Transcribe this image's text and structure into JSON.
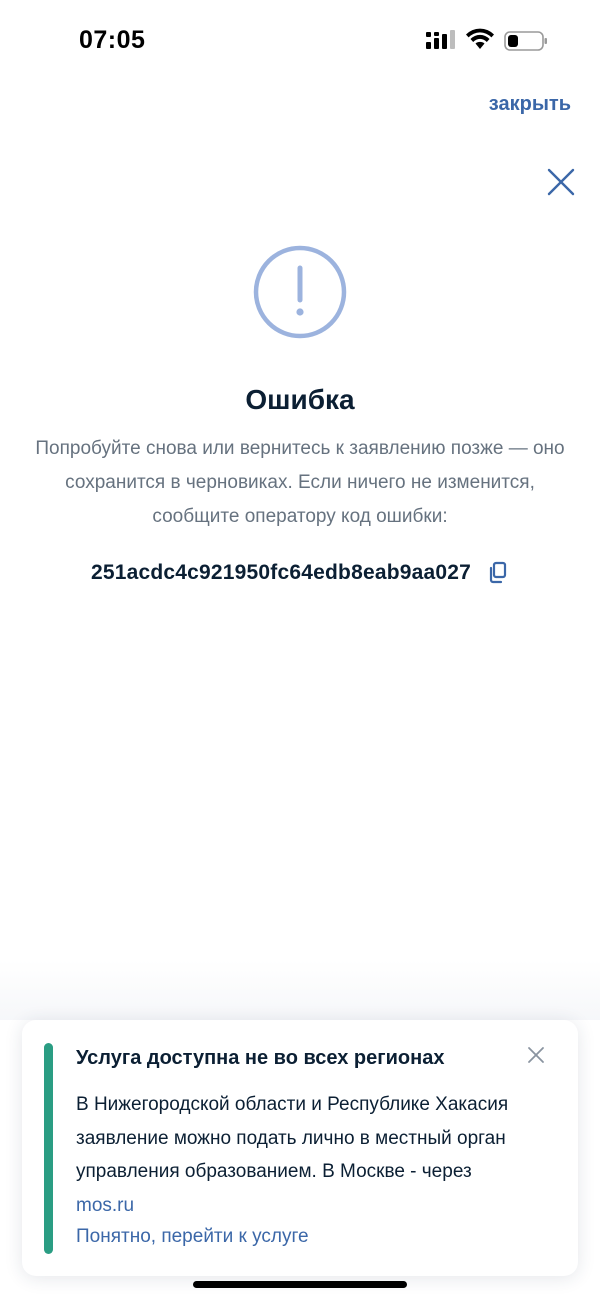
{
  "status_bar": {
    "time": "07:05",
    "icons": [
      "signal-icon",
      "wifi-icon",
      "battery-icon"
    ]
  },
  "header": {
    "close_link_label": "закрыть",
    "close_icon": "close-icon"
  },
  "error": {
    "icon": "exclamation-circle-icon",
    "title": "Ошибка",
    "description": "Попробуйте снова или вернитесь к заявлению позже — оно сохранится в черновиках. Если ничего не изменится, сообщите оператору код ошибки:",
    "code": "251acdc4c921950fc64edb8eab9aa027",
    "copy_icon": "copy-icon"
  },
  "notice": {
    "title": "Услуга доступна не во всех регионах",
    "text_before_link": "В Нижегородской области и Республике Хакасия заявление можно подать лично в местный орган управления образованием. В Москве - через ",
    "link_label": "mos.ru",
    "action_label": "Понятно, перейти к услуге",
    "accent_color": "#2a9d83"
  },
  "colors": {
    "link": "#3b67a8",
    "icon_outline": "#9cb3de",
    "text_primary": "#0b1f33",
    "text_secondary": "#66727f"
  }
}
